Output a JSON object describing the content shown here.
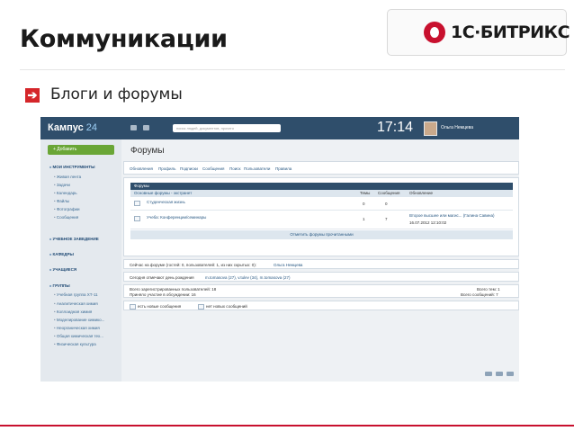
{
  "slide": {
    "title": "Коммуникации",
    "subtitle": "Блоги и форумы",
    "bullet_glyph": "➔",
    "logo_text": "1С·БИТРИКС"
  },
  "colors": {
    "accent_red": "#c8102e",
    "topbar": "#2f4e6b",
    "add_green": "#6aa636"
  },
  "app": {
    "brand": "Кампус",
    "brand_num": "24",
    "search_placeholder": "поиск людей, документов, прочего",
    "clock": "17:14",
    "user": "Ольга Немцева"
  },
  "sidebar": {
    "add_label": "+ Добавить",
    "items": [
      {
        "label": "МОИ ИНСТРУМЕНТЫ",
        "type": "hd"
      },
      {
        "label": "Живая лента",
        "type": "sub"
      },
      {
        "label": "Задачи",
        "type": "sub"
      },
      {
        "label": "Календарь",
        "type": "sub"
      },
      {
        "label": "Файлы",
        "type": "sub"
      },
      {
        "label": "Фотографии",
        "type": "sub"
      },
      {
        "label": "Сообщения",
        "type": "sub"
      },
      {
        "label": "УЧЕБНОЕ ЗАВЕДЕНИЕ",
        "type": "hd"
      },
      {
        "label": "КАФЕДРЫ",
        "type": "hd"
      },
      {
        "label": "УЧАЩИЕСЯ",
        "type": "hd"
      },
      {
        "label": "ГРУППЫ",
        "type": "hd"
      },
      {
        "label": "Учебная группа ХТ-11",
        "type": "sub"
      },
      {
        "label": "Аналитическая химия",
        "type": "sub"
      },
      {
        "label": "Коллоидная химия",
        "type": "sub"
      },
      {
        "label": "Моделирование химико...",
        "type": "sub"
      },
      {
        "label": "Неорганическая химия",
        "type": "sub"
      },
      {
        "label": "Общая химическая тех...",
        "type": "sub"
      },
      {
        "label": "Физическая культура",
        "type": "sub"
      }
    ]
  },
  "main": {
    "page_title": "Форумы",
    "nav": [
      "Обновления",
      "Профиль",
      "Подписки",
      "Сообщения",
      "Поиск",
      "Пользователи",
      "Правила"
    ],
    "table": {
      "header": "Форумы",
      "group": "Основные форумы - экстранет",
      "col_topics": "Темы",
      "col_messages": "Сообщения",
      "col_updates": "Обновление",
      "rows": [
        {
          "title": "Студенческая жизнь",
          "topics": "0",
          "messages": "0",
          "update": "",
          "update_date": ""
        },
        {
          "title": "Учеба: Конференции/семинары",
          "topics": "1",
          "messages": "7",
          "update": "Второе высшее или магис... (Галина Савина)",
          "update_date": "16.07.2012 12:10:02"
        }
      ],
      "footer": "Отметить форумы прочитанными"
    },
    "online": {
      "text": "Сейчас на форуме (гостей: 0, пользователей: 1, из них скрытых: 0):",
      "user": "Ольга Немцева"
    },
    "birthdays": {
      "text": "Сегодня отмечают день рождения",
      "people": "m.tomasova (27), v.tulev (34), m.tomasova (27)"
    },
    "stats": {
      "registered": "Всего зарегистрированных пользователей: 18",
      "participated": "Приняло участие в обсуждении: 16",
      "topics": "Всего тем: 1",
      "messages": "Всего сообщений: 7"
    },
    "legend": {
      "new": "есть новые сообщения",
      "none": "нет новых сообщений"
    }
  }
}
